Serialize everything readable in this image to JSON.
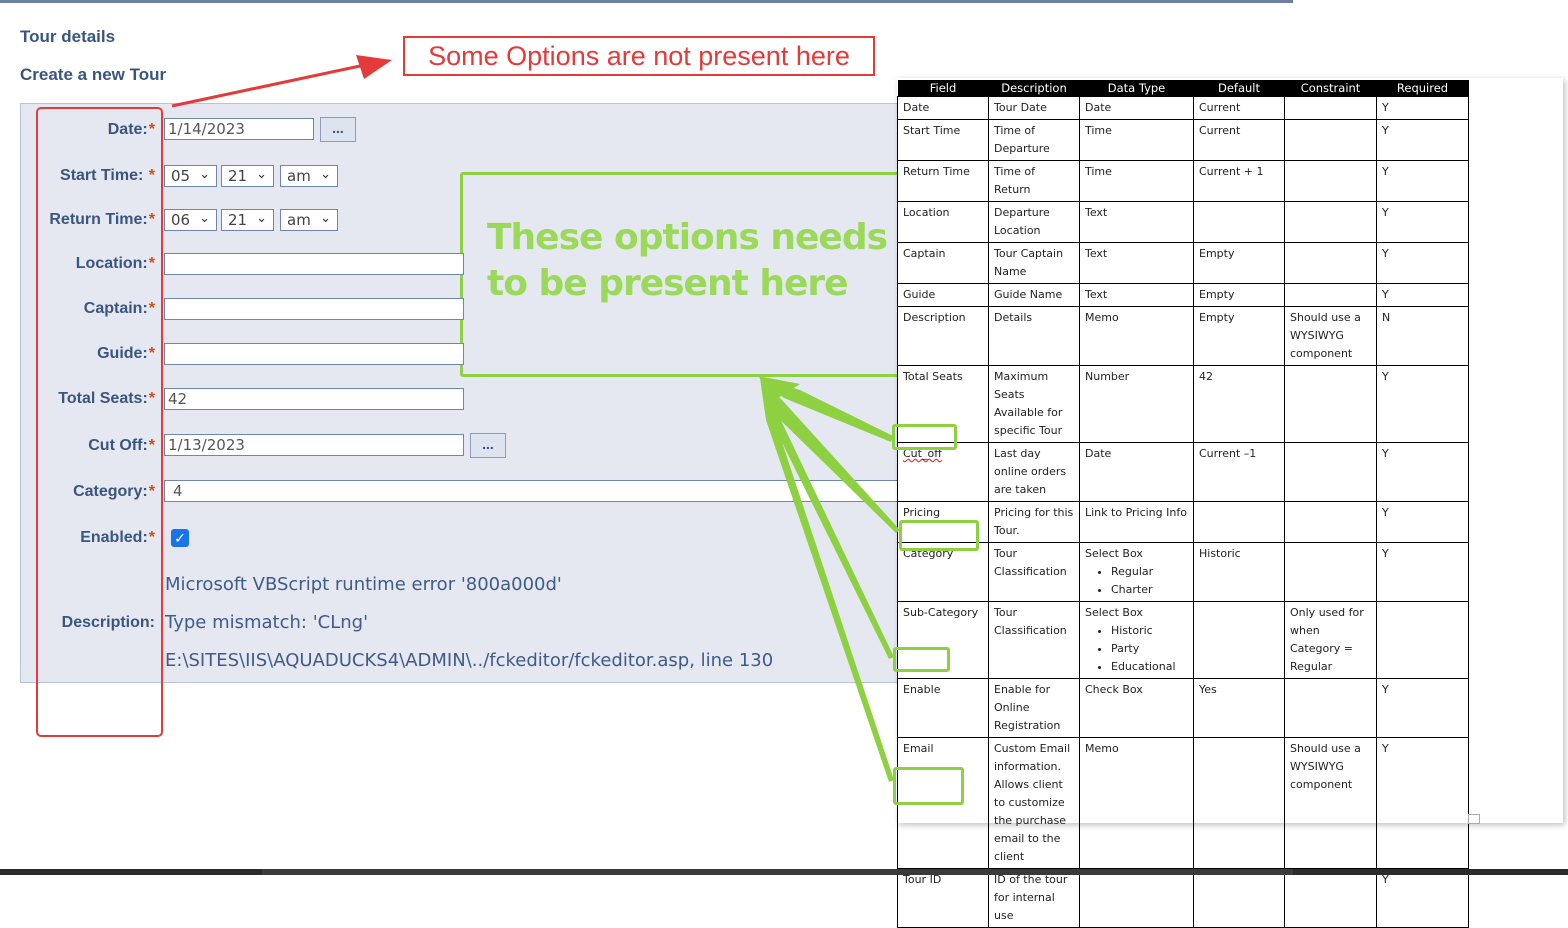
{
  "headings": {
    "tour_details": "Tour details",
    "create_new_tour": "Create a new Tour"
  },
  "form": {
    "required_mark": "*",
    "date": {
      "label": "Date:",
      "value": "1/14/2023",
      "picker_label": "..."
    },
    "start_time": {
      "label": "Start Time:",
      "hour": "05",
      "minute": "21",
      "ampm": "am"
    },
    "return_time": {
      "label": "Return Time:",
      "hour": "06",
      "minute": "21",
      "ampm": "am"
    },
    "location": {
      "label": "Location:",
      "value": ""
    },
    "captain": {
      "label": "Captain:",
      "value": ""
    },
    "guide": {
      "label": "Guide:",
      "value": ""
    },
    "total_seats": {
      "label": "Total Seats:",
      "value": "42"
    },
    "cut_off": {
      "label": "Cut Off:",
      "value": "1/13/2023",
      "picker_label": "..."
    },
    "category": {
      "label": "Category:",
      "value": "4"
    },
    "enabled": {
      "label": "Enabled:",
      "checked": true
    },
    "description": {
      "label": "Description:",
      "error_line1": "Microsoft VBScript runtime error '800a000d'",
      "error_line2": "Type mismatch: 'CLng'",
      "error_line3": "E:\\SITES\\IIS\\AQUADUCKS4\\ADMIN\\../fckeditor/fckeditor.asp, line 130"
    }
  },
  "annotations": {
    "red_callout": "Some Options are not present here",
    "green_callout": "These options needs to be present here",
    "red_color": "#e53a3a",
    "green_color": "#8dd142"
  },
  "spec_table": {
    "headers": [
      "Field",
      "Description",
      "Data Type",
      "Default",
      "Constraint",
      "Required"
    ],
    "rows": [
      {
        "field": "Date",
        "description": "Tour Date",
        "type": "Date",
        "type_items": [],
        "default": "Current",
        "constraint": "",
        "required": "Y"
      },
      {
        "field": "Start Time",
        "description": "Time of Departure",
        "type": "Time",
        "type_items": [],
        "default": "Current",
        "constraint": "",
        "required": "Y"
      },
      {
        "field": "Return Time",
        "description": "Time of Return",
        "type": "Time",
        "type_items": [],
        "default": "Current + 1",
        "constraint": "",
        "required": "Y"
      },
      {
        "field": "Location",
        "description": "Departure Location",
        "type": "Text",
        "type_items": [],
        "default": "",
        "constraint": "",
        "required": "Y"
      },
      {
        "field": "Captain",
        "description": "Tour Captain Name",
        "type": "Text",
        "type_items": [],
        "default": "Empty",
        "constraint": "",
        "required": "Y"
      },
      {
        "field": "Guide",
        "description": "Guide Name",
        "type": "Text",
        "type_items": [],
        "default": "Empty",
        "constraint": "",
        "required": "Y"
      },
      {
        "field": "Description",
        "description": "Details",
        "type": "Memo",
        "type_items": [],
        "default": "Empty",
        "constraint": "Should use a WYSIWYG component",
        "required": "N"
      },
      {
        "field": "Total Seats",
        "description": "Maximum Seats Available for specific Tour",
        "type": "Number",
        "type_items": [],
        "default": "42",
        "constraint": "",
        "required": "Y"
      },
      {
        "field": "Cut_off",
        "description": "Last day online orders are taken",
        "type": "Date",
        "type_items": [],
        "default": "Current –1",
        "constraint": "",
        "required": "Y"
      },
      {
        "field": "Pricing",
        "description": "Pricing for this Tour.",
        "type": "Link to Pricing Info",
        "type_items": [],
        "default": "",
        "constraint": "",
        "required": "Y"
      },
      {
        "field": "Category",
        "description": "Tour Classification",
        "type": "Select Box",
        "type_items": [
          "Regular",
          "Charter"
        ],
        "default": "Historic",
        "constraint": "",
        "required": "Y"
      },
      {
        "field": "Sub-Category",
        "description": "Tour Classification",
        "type": "Select Box",
        "type_items": [
          "Historic",
          "Party",
          "Educational"
        ],
        "default": "",
        "constraint": "Only used for when Category = Regular",
        "required": ""
      },
      {
        "field": "Enable",
        "description": "Enable for Online Registration",
        "type": "Check Box",
        "type_items": [],
        "default": "Yes",
        "constraint": "",
        "required": "Y"
      },
      {
        "field": "Email",
        "description": "Custom Email information. Allows client to customize the purchase email to the client",
        "type": "Memo",
        "type_items": [],
        "default": "",
        "constraint": "Should use a WYSIWYG component",
        "required": "Y"
      },
      {
        "field": "Tour ID",
        "description": "ID of the tour for internal use",
        "type": "",
        "type_items": [],
        "default": "",
        "constraint": "",
        "required": "Y"
      }
    ]
  }
}
